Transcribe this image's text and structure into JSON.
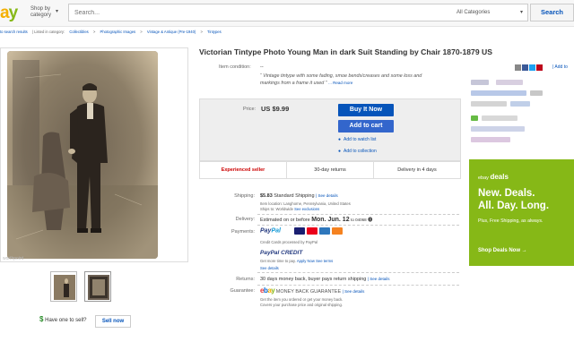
{
  "header": {
    "logo_a": "a",
    "logo_y": "y",
    "shop_by_line1": "Shop by",
    "shop_by_line2": "category",
    "search_placeholder": "Search...",
    "category": "All Categories",
    "search_button": "Search"
  },
  "breadcrumb": [
    "to search results",
    "| Listed in category:",
    "Collectibles",
    ">",
    "Photographic Images",
    ">",
    "Vintage & Antique (Pre-1940)",
    ">",
    "Tintypes"
  ],
  "gallery": {
    "watermark": "worthpoint"
  },
  "sell": {
    "prompt": "Have one to sell?",
    "button": "Sell now"
  },
  "item": {
    "title": "Victorian Tintype Photo Young Man in dark Suit Standing by Chair 1870-1879 US",
    "condition_label": "Item condition:",
    "condition_value": "--",
    "condition_quote": "“ Vintage tintype with some fading, smoe bends/creases and some loss and markings from a frame it used ”",
    "read_more": "... Read more",
    "add_to": "| Add to"
  },
  "buy": {
    "price_label": "Price:",
    "price": "US $9.99",
    "buy_now": "Buy It Now",
    "add_cart": "Add to cart",
    "watch": "Add to watch list",
    "collection": "Add to collection"
  },
  "stats": {
    "seller": "Experienced seller",
    "returns": "30-day returns",
    "delivery": "Delivery in 4 days"
  },
  "shipping": {
    "label": "Shipping:",
    "value": "$5.83",
    "method": "Standard Shipping",
    "details": "| See details",
    "location": "Item location: Langhorne, Pennsylvania, United States",
    "ships_to": "Ships to: Worldwide",
    "exclusions": "See exclusions"
  },
  "delivery": {
    "label": "Delivery:",
    "prefix": "Estimated on or before",
    "date": "Mon. Jun. 12",
    "suffix": "to 04068"
  },
  "payments": {
    "label": "Payments:",
    "paypal": "Pay",
    "pal": "Pal",
    "credit_note": "Credit Cards processed by PayPal",
    "paypal_credit": "PayPal CREDIT",
    "credit_line": "Get more time to pay.",
    "apply": "Apply Now",
    "terms": "See terms",
    "see_details": "See details"
  },
  "returns": {
    "label": "Returns:",
    "value": "30 days money back, buyer pays return shipping",
    "details": "| See details"
  },
  "guarantee": {
    "label": "Guarantee:",
    "text": "MONEY BACK GUARANTEE",
    "details": "| See details",
    "line1": "Get the item you ordered or get your money back.",
    "line2": "Covers your purchase price and original shipping."
  },
  "deals": {
    "brand_prefix": "ebay",
    "brand": "deals",
    "line1": "New. Deals.",
    "line2": "All. Day. Long.",
    "sub": "Plus, Free Shipping, as always.",
    "cta": "Shop Deals Now →"
  },
  "colors": {
    "link": "#0654ba",
    "deals_bg": "#86b817",
    "seller_red": "#cc0000"
  }
}
